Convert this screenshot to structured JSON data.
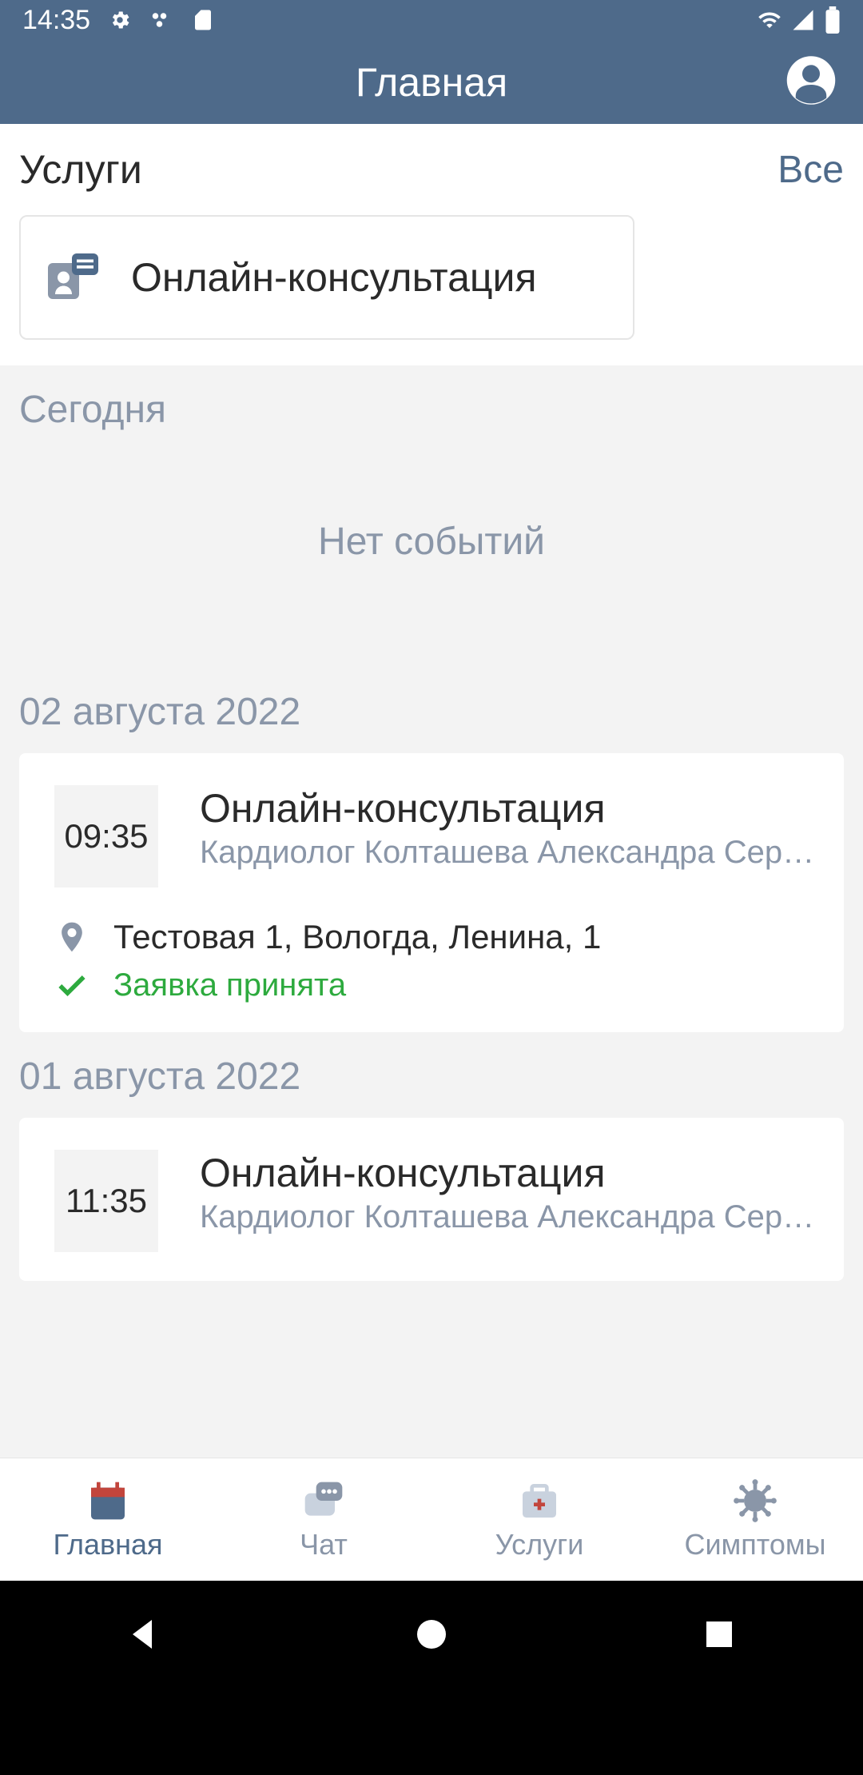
{
  "status": {
    "time": "14:35"
  },
  "header": {
    "title": "Главная"
  },
  "services": {
    "title": "Услуги",
    "all_label": "Все",
    "card_label": "Онлайн-консультация"
  },
  "sections": [
    {
      "label": "Сегодня",
      "empty_text": "Нет событий",
      "events": []
    },
    {
      "label": "02 августа 2022",
      "events": [
        {
          "time": "09:35",
          "title": "Онлайн-консультация",
          "subtitle": "Кардиолог Колташева Александра Сер…",
          "location": "Тестовая 1, Вологда, Ленина, 1",
          "status": "Заявка принята",
          "accent": "#F5B93E"
        }
      ]
    },
    {
      "label": "01 августа 2022",
      "events": [
        {
          "time": "11:35",
          "title": "Онлайн-консультация",
          "subtitle": "Кардиолог Колташева Александра Сер…",
          "accent": "#F5B93E"
        }
      ]
    }
  ],
  "nav": {
    "home": "Главная",
    "chat": "Чат",
    "services": "Услуги",
    "symptoms": "Симптомы"
  },
  "colors": {
    "primary": "#4E6A8A",
    "accent": "#F5B93E",
    "success": "#2DAA3E",
    "muted": "#8A96A8",
    "bg": "#F3F3F3"
  }
}
